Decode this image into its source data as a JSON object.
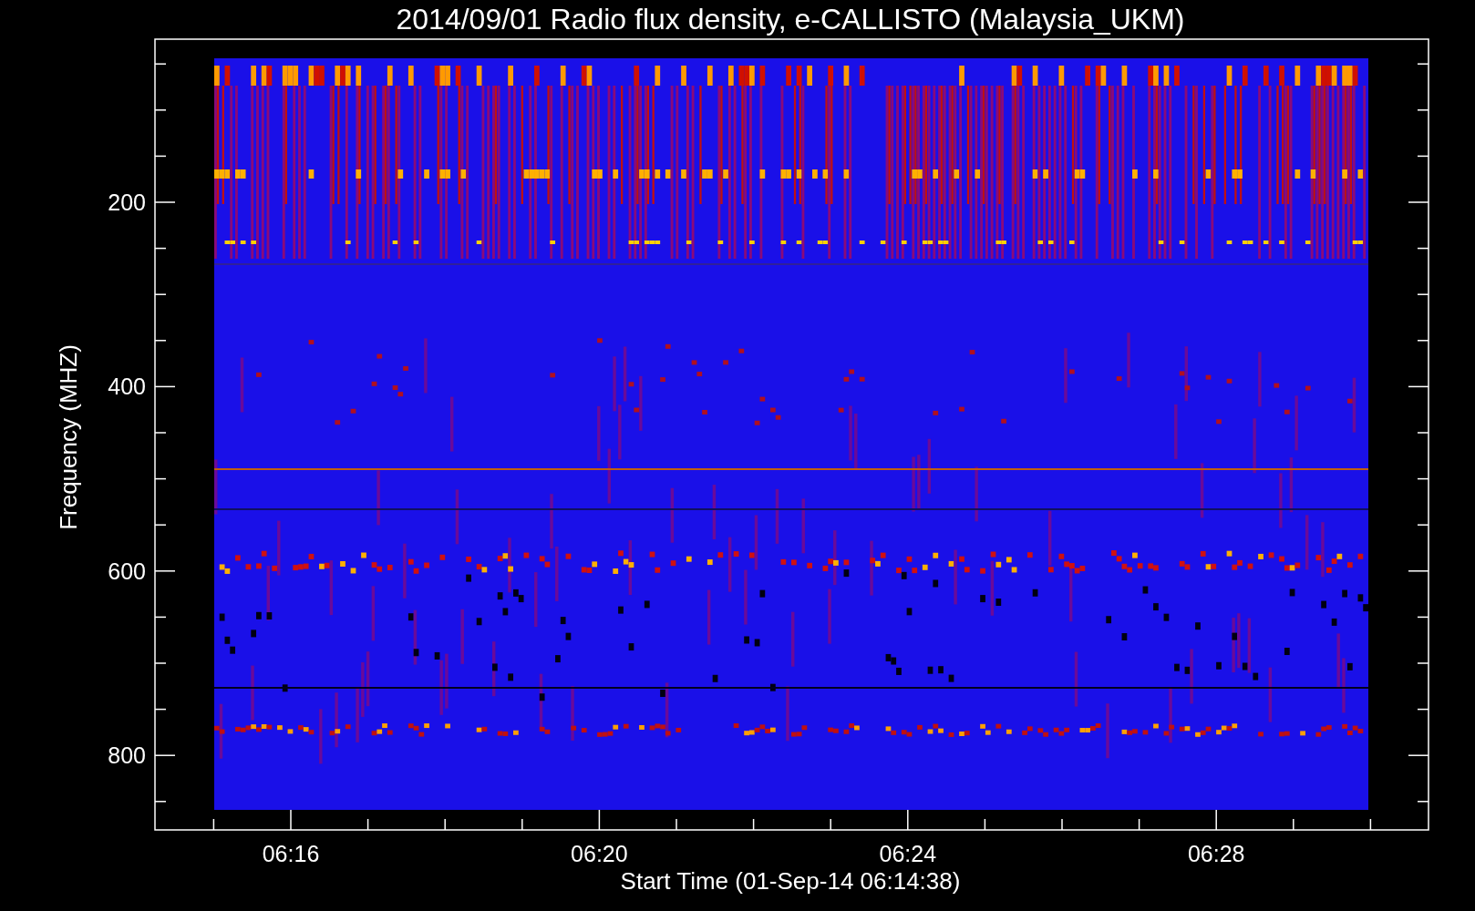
{
  "plot": {
    "title": "2014/09/01  Radio flux density, e-CALLISTO (Malaysia_UKM)",
    "xlabel": "Start Time (01-Sep-14 06:14:38)",
    "ylabel": "Frequency (MHZ)",
    "yticks": [
      "200",
      "400",
      "600",
      "800"
    ],
    "xticks": [
      "06:16",
      "06:20",
      "06:24",
      "06:28"
    ]
  }
}
